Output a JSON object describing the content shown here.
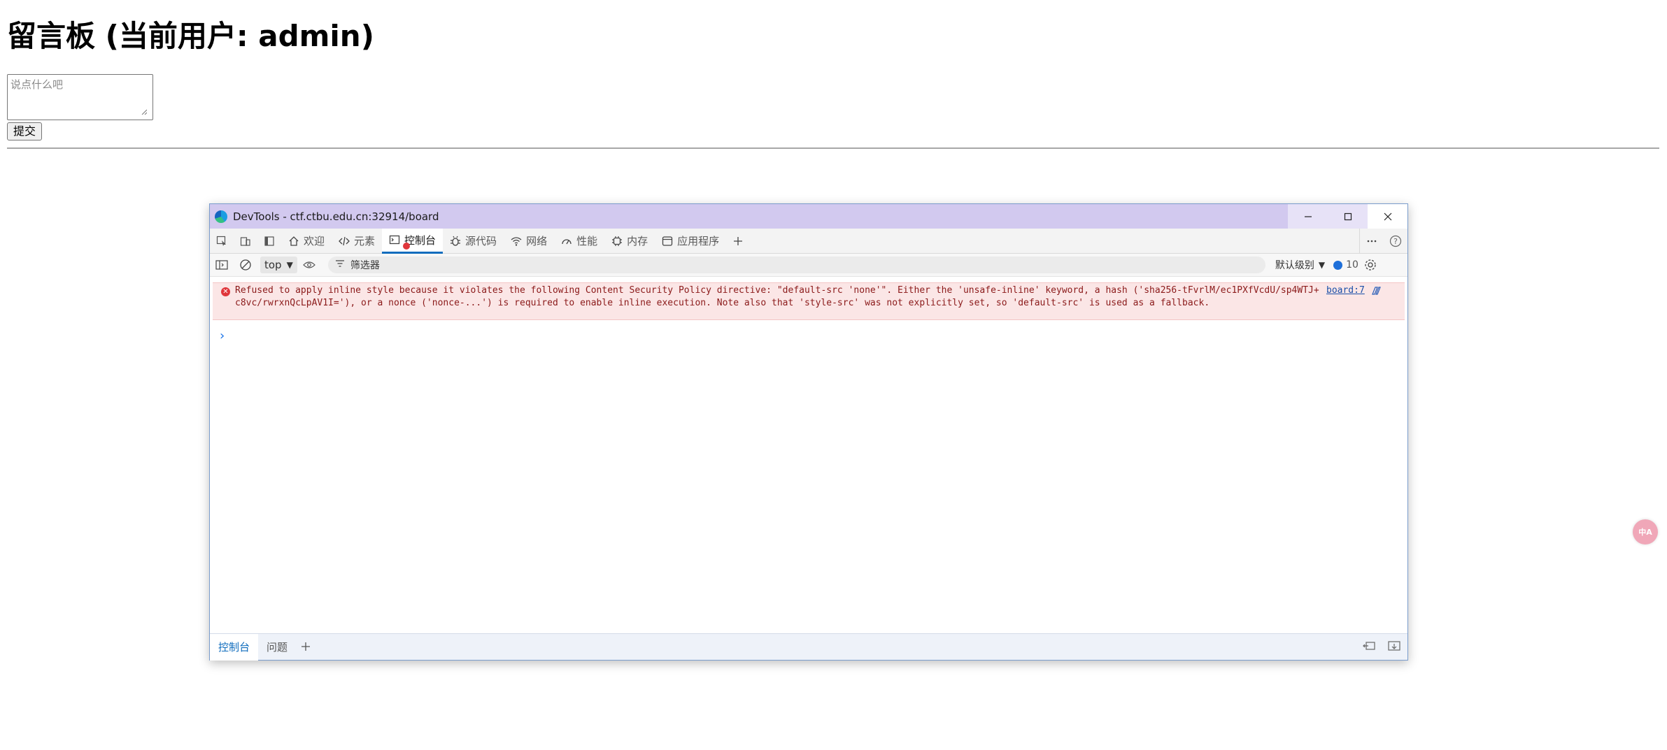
{
  "page": {
    "title": "留言板 (当前用户: admin)",
    "textarea_placeholder": "说点什么吧",
    "submit_label": "提交",
    "translate_badge": "中A"
  },
  "devtools": {
    "window_title": "DevTools - ctf.ctbu.edu.cn:32914/board",
    "tabs": [
      {
        "label": "欢迎",
        "icon": "home-icon"
      },
      {
        "label": "元素",
        "icon": "code-icon"
      },
      {
        "label": "控制台",
        "icon": "console-icon",
        "active": true
      },
      {
        "label": "源代码",
        "icon": "bug-icon"
      },
      {
        "label": "网络",
        "icon": "wifi-icon"
      },
      {
        "label": "性能",
        "icon": "gauge-icon"
      },
      {
        "label": "内存",
        "icon": "chip-icon"
      },
      {
        "label": "应用程序",
        "icon": "app-window-icon"
      }
    ],
    "console_bar": {
      "context": "top",
      "filter_placeholder": "筛选器",
      "level": "默认级别",
      "issues_count": "10"
    },
    "messages": [
      {
        "level": "error",
        "text": "Refused to apply inline style because it violates the following Content Security Policy directive: \"default-src 'none'\". Either the 'unsafe-inline' keyword, a hash ('sha256-tFvrlM/ec1PXfVcdU/sp4WTJ+c8vc/rwrxnQcLpAV1I='), or a nonce ('nonce-...') is required to enable inline execution. Note also that 'style-src' was not explicitly set, so 'default-src' is used as a fallback.",
        "source": "board:7"
      }
    ],
    "drawer_tabs": [
      {
        "label": "控制台",
        "active": true
      },
      {
        "label": "问题"
      }
    ]
  },
  "colors": {
    "titlebar": "#d2c9ef",
    "active_tab_underline": "#0f6cbd",
    "error_bg": "#fbe6e6",
    "error_icon": "#e0363b"
  }
}
